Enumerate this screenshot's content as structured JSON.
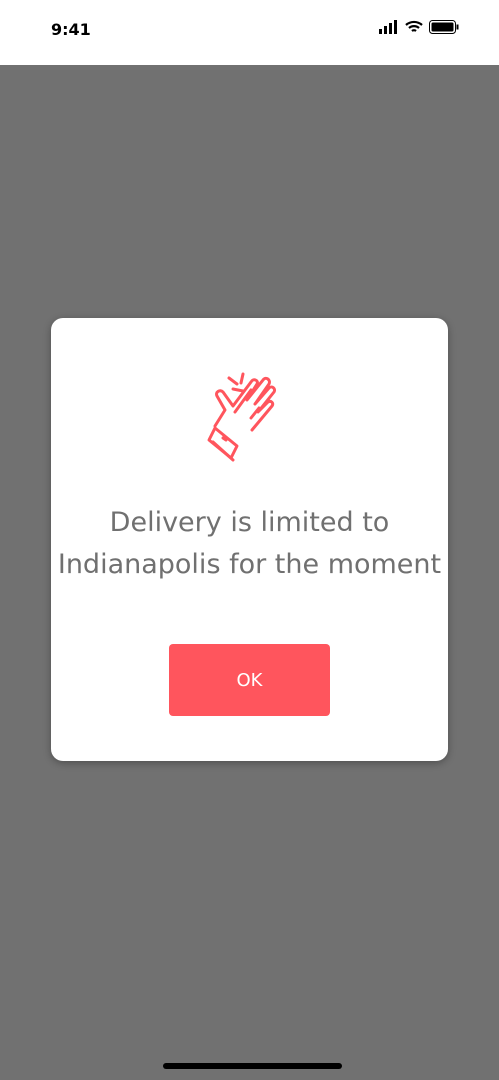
{
  "status": {
    "time": "9:41"
  },
  "dialog": {
    "icon": "clapping-hands-icon",
    "message": "Delivery is limited to Indianapolis for the moment",
    "ok_label": "OK",
    "accent": "#ff555d"
  }
}
